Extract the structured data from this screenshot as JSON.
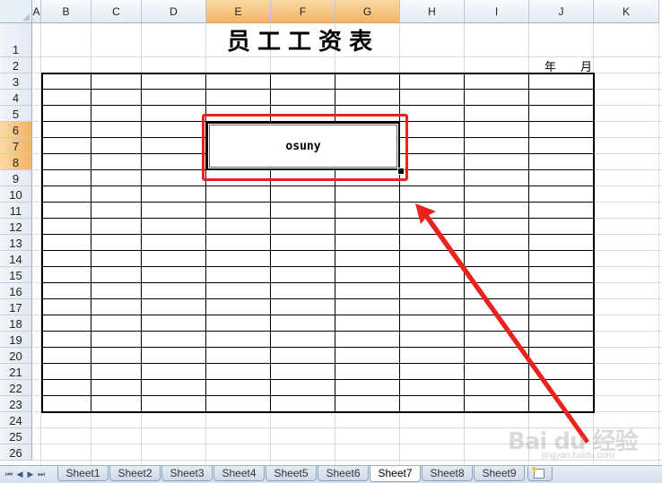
{
  "columns": [
    "A",
    "B",
    "C",
    "D",
    "E",
    "F",
    "G",
    "H",
    "I",
    "J",
    "K"
  ],
  "selected_columns": [
    "E",
    "F",
    "G"
  ],
  "rows": [
    "1",
    "2",
    "3",
    "4",
    "5",
    "6",
    "7",
    "8",
    "9",
    "10",
    "11",
    "12",
    "13",
    "14",
    "15",
    "16",
    "17",
    "18",
    "19",
    "20",
    "21",
    "22",
    "23",
    "24",
    "25",
    "26"
  ],
  "selected_rows": [
    "6",
    "7",
    "8"
  ],
  "sheet": {
    "title": "员工工资表",
    "year_label": "年",
    "month_label": "月",
    "merged_cell_value": "osuny"
  },
  "tabs": [
    "Sheet1",
    "Sheet2",
    "Sheet3",
    "Sheet4",
    "Sheet5",
    "Sheet6",
    "Sheet7",
    "Sheet8",
    "Sheet9"
  ],
  "active_tab": "Sheet7",
  "tab_nav": [
    "first-sheet",
    "prev-sheet",
    "next-sheet",
    "last-sheet"
  ],
  "annotation": {
    "highlight_color": "#e8231d",
    "arrow_color": "#e8231d"
  },
  "watermark": {
    "logo": "Bai du 经验",
    "url": "jingyan.baidu.com"
  }
}
